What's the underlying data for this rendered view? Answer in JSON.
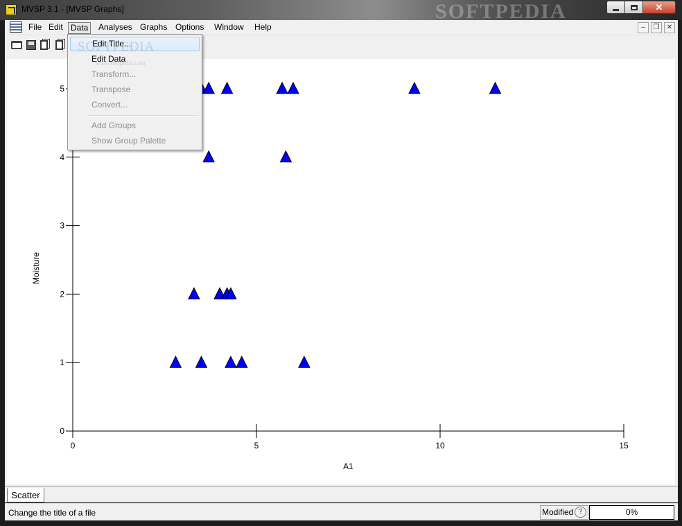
{
  "window": {
    "title": "MVSP 3.1 - [MVSP Graphs]",
    "watermark": "SOFTPEDIA",
    "close_label": "✕"
  },
  "menubar": {
    "items": [
      "File",
      "Edit",
      "Data",
      "Analyses",
      "Graphs",
      "Options",
      "Window",
      "Help"
    ],
    "active": "Data"
  },
  "data_menu": {
    "items": [
      {
        "label": "Edit Title...",
        "enabled": true,
        "highlighted": true
      },
      {
        "label": "Edit Data",
        "enabled": true
      },
      {
        "label": "Transform...",
        "enabled": false
      },
      {
        "label": "Transpose",
        "enabled": false
      },
      {
        "label": "Convert...",
        "enabled": false
      },
      {
        "label": "Add Groups",
        "enabled": false
      },
      {
        "label": "Show Group Palette",
        "enabled": false
      }
    ],
    "watermark": "SOFTPEDIA",
    "watermark_url": "www.softpedia.com"
  },
  "toolbar": {
    "icons": [
      "open-icon",
      "save-icon",
      "copy-icon",
      "clipboard-icon"
    ]
  },
  "chart_data": {
    "type": "scatter",
    "xlabel": "A1",
    "ylabel": "Moisture",
    "xlim": [
      0,
      15
    ],
    "ylim": [
      0,
      5
    ],
    "x_ticks": [
      0,
      5,
      10,
      15
    ],
    "y_ticks": [
      0,
      1,
      2,
      3,
      4,
      5
    ],
    "marker": "triangle",
    "marker_color": "#0000ff",
    "points": [
      {
        "x": 3.5,
        "y": 5
      },
      {
        "x": 3.7,
        "y": 5
      },
      {
        "x": 4.2,
        "y": 5
      },
      {
        "x": 5.7,
        "y": 5
      },
      {
        "x": 6.0,
        "y": 5
      },
      {
        "x": 9.3,
        "y": 5
      },
      {
        "x": 11.5,
        "y": 5
      },
      {
        "x": 3.7,
        "y": 4
      },
      {
        "x": 5.8,
        "y": 4
      },
      {
        "x": 3.3,
        "y": 2
      },
      {
        "x": 4.0,
        "y": 2
      },
      {
        "x": 4.2,
        "y": 2
      },
      {
        "x": 4.3,
        "y": 2
      },
      {
        "x": 2.8,
        "y": 1
      },
      {
        "x": 3.5,
        "y": 1
      },
      {
        "x": 4.3,
        "y": 1
      },
      {
        "x": 4.6,
        "y": 1
      },
      {
        "x": 6.3,
        "y": 1
      }
    ]
  },
  "tabs": [
    "Scatter"
  ],
  "status": {
    "message": "Change the title of a file",
    "modified_label": "Modified",
    "progress": "0%"
  }
}
